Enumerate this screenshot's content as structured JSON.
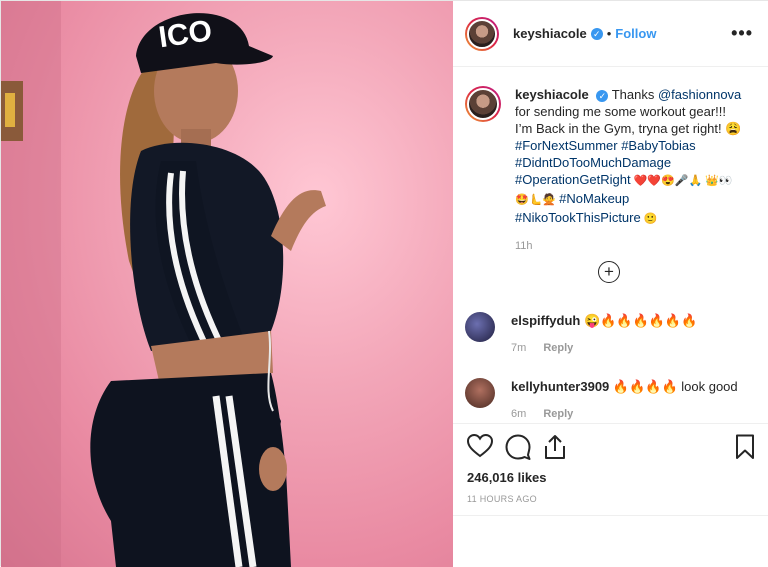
{
  "post": {
    "username": "keyshiacole",
    "follow_label": "Follow",
    "dot": "•",
    "more_label": "•••",
    "caption": {
      "text1": "Thanks ",
      "mention": "@fashionnova",
      "text2": " for sending me some workout gear!!! I’m Back in the Gym, tryna get right! 😩 ",
      "tag1": "#ForNextSummer",
      "tag2": "#BabyTobias",
      "tag3": "#DidntDoTooMuchDamage",
      "tag4": "#OperationGetRight",
      "emoji1": " ❤️❤️😍🎤🙏 ",
      "emoji2": "👑👀🤩🫷🙅 ",
      "tag5": "#NoMakeup",
      "tag6": "#NikoTookThisPicture",
      "emoji3": " 🙂",
      "time": "11h"
    },
    "load_more_label": "+",
    "comments": [
      {
        "user": "elspiffyduh",
        "text": "😜🔥🔥🔥🔥🔥🔥",
        "time": "7m",
        "reply": "Reply",
        "avatar_color": "#3b3a6e"
      },
      {
        "user": "kellyhunter3909",
        "text": "🔥🔥🔥🔥 look good",
        "time": "6m",
        "reply": "Reply",
        "avatar_color": "#8a4a3c"
      }
    ],
    "likes": "246,016 likes",
    "timestamp": "11 HOURS AGO",
    "hat_text": "ICO"
  }
}
